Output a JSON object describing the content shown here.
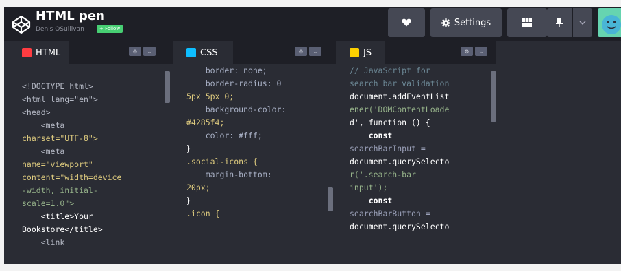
{
  "header": {
    "title": "HTML pen",
    "author": "Denis OSullivan",
    "follow_label": "+ Follow",
    "settings_label": "Settings"
  },
  "icons": {
    "logo": "codepen-logo-icon",
    "heart": "heart-icon",
    "settings": "gear-icon",
    "layout": "layout-grid-icon",
    "pin": "pin-icon",
    "chevron": "chevron-down-icon"
  },
  "colors": {
    "html": "#ff3c41",
    "css": "#0ebeff",
    "js": "#fcd000",
    "follow": "#47cf73"
  },
  "panels": {
    "html": {
      "label": "HTML",
      "lines": [
        "<!DOCTYPE html>",
        "<html lang=\"en\">",
        "<head>",
        "    <meta",
        "charset=\"UTF-8\">",
        "    <meta",
        "name=\"viewport\"",
        "content=\"width=device",
        "-width, initial-",
        "scale=1.0\">",
        "    <title>Your",
        "Bookstore</title>",
        "    <link"
      ]
    },
    "css": {
      "label": "CSS",
      "lines": [
        "    border: none;",
        "    border-radius: 0",
        "5px 5px 0;",
        "    background-color:",
        "#4285f4;",
        "    color: #fff;",
        "}",
        "",
        ".social-icons {",
        "    margin-bottom:",
        "20px;",
        "}",
        "",
        ".icon {"
      ]
    },
    "js": {
      "label": "JS",
      "lines": [
        "",
        "// JavaScript for",
        "search bar validation",
        "document.addEventList",
        "ener('DOMContentLoade",
        "d', function () {",
        "    const",
        "searchBarInput =",
        "document.querySelecto",
        "r('.search-bar",
        "input');",
        "    const",
        "searchBarButton =",
        "document.querySelecto"
      ]
    }
  }
}
